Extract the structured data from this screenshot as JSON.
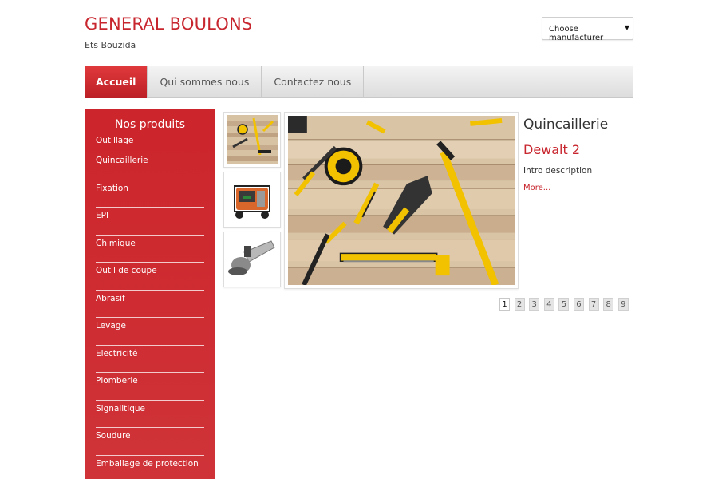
{
  "header": {
    "title": "GENERAL BOULONS",
    "subtitle": "Ets Bouzida",
    "manufacturer_select": "Choose manufacturer"
  },
  "nav": {
    "items": [
      {
        "label": "Accueil"
      },
      {
        "label": "Qui sommes nous"
      },
      {
        "label": "Contactez nous"
      }
    ]
  },
  "sidebar": {
    "title": "Nos produits",
    "items": [
      {
        "label": "Outillage"
      },
      {
        "label": "Quincaillerie"
      },
      {
        "label": "Fixation"
      },
      {
        "label": "EPI"
      },
      {
        "label": "Chimique"
      },
      {
        "label": "Outil de coupe"
      },
      {
        "label": "Abrasif"
      },
      {
        "label": "Levage"
      },
      {
        "label": "Electricité"
      },
      {
        "label": "Plomberie"
      },
      {
        "label": "Signalitique"
      },
      {
        "label": "Soudure"
      },
      {
        "label": "Emballage de protection"
      }
    ]
  },
  "featured": {
    "category": "Quincaillerie",
    "name": "Dewalt 2",
    "intro": "Intro description",
    "more": "More..."
  },
  "pager": {
    "pages": [
      "1",
      "2",
      "3",
      "4",
      "5",
      "6",
      "7",
      "8",
      "9"
    ],
    "current": "1"
  },
  "colors": {
    "brand_red": "#c8262e",
    "sidebar_red": "#cc252b",
    "tool_yellow": "#f2c200"
  }
}
